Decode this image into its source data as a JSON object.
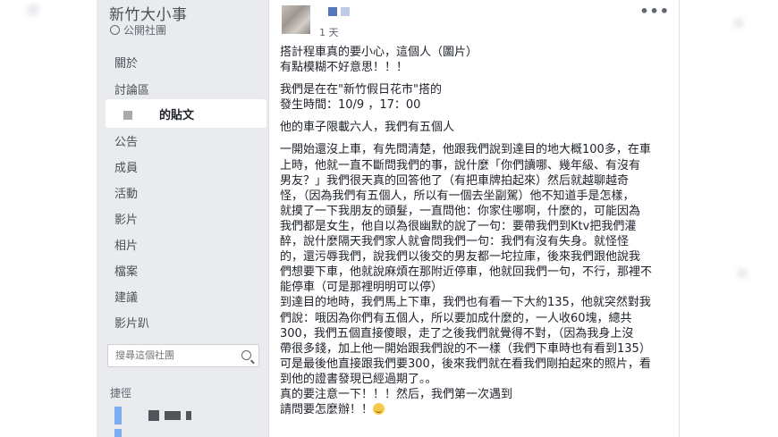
{
  "group": {
    "name": "新竹大小事",
    "type": "公開社團"
  },
  "nav": {
    "items": [
      "關於",
      "討論區",
      "公告",
      "成員",
      "活動",
      "影片",
      "相片",
      "檔案",
      "建議",
      "影片趴"
    ],
    "active_label": "的貼文"
  },
  "search": {
    "placeholder": "搜尋這個社團"
  },
  "shortcuts": {
    "title": "捷徑"
  },
  "post": {
    "timestamp": "1 天",
    "more": "•••",
    "paragraphs": [
      [
        "搭計程車真的要小心，這個人（圖片）",
        "有點模糊不好意思！！！"
      ],
      [
        "我們是在在\"新竹假日花市\"搭的",
        "發生時間：10/9 ，17：00"
      ],
      [
        "他的車子限載六人，我們有五個人"
      ],
      [
        "一開始還沒上車，有先問清楚，他跟我們說到達目的地大概100多，在車",
        "上時，他就一直不斷問我們的事，說什麼「你們讀哪、幾年級、有沒有",
        "男友？」我們很天真的回答他了（有把車牌拍起來）然后就越聊越奇",
        "怪，（因為我們有五個人，所以有一個去坐副駕）他不知道手是怎樣，",
        "就摸了一下我朋友的頭髮，一直問他：你家住哪啊，什麼的，可能因為",
        "我們都是女生，他自以為很幽默的說了一句：要帶我們到Ktv把我們灌",
        "醉，說什麼隔天我們家人就會問我們一句：我們有沒有失身。就怪怪",
        "的，還污辱我們，說我們以後交的男友都一坨拉庫，後來我們跟他說我",
        "們想要下車，他就說麻煩在那附近停車，他就回我們一句，不行，那裡不",
        "能停車（可是那裡明明可以停）",
        "到達目的地時，我們馬上下車，我們也有看一下大約135，他就突然對我",
        "們說：哦因為你們有五個人，所以要加成什麼的，一人收60塊，總共",
        "300，我們五個直接傻眼，走了之後我們就覺得不對，（因為我身上沒",
        "帶很多錢，加上他一開始跟我們說的不一樣（我們下車時也有看到135）",
        "可是最後他直接跟我們要300，後來我們就在看我們剛拍起來的照片，看",
        "到他的證書發現已經過期了。。",
        "真的要注意一下！！！然后，我們第一次遇到",
        "請問要怎麼辦！！"
      ]
    ]
  },
  "colors": {
    "sidebar_bg": "#e9ebee",
    "text": "#1d2129",
    "muted": "#606770",
    "brand": "#4267b2"
  }
}
